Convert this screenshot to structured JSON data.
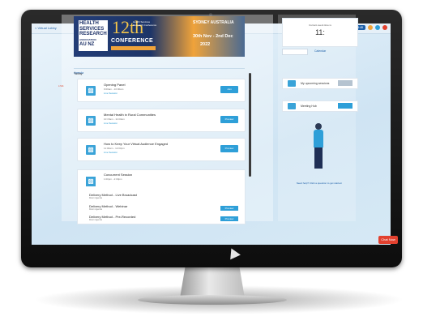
{
  "topbar": {
    "back_label": "< Virtual Lobby",
    "user_label": "Your Profile",
    "timer": "13:48"
  },
  "banner": {
    "org_lines": [
      "HEALTH",
      "SERVICES",
      "RESEARCH",
      "ASSOCIATION",
      "AU NZ"
    ],
    "edition": "12th",
    "subtitle": "Health Services Research Conference",
    "conference": "CONFERENCE",
    "city": "SYDNEY AUSTRALIA",
    "dates": "30th Nov - 2nd Dec",
    "year": "2022"
  },
  "tab_label": "Agenda",
  "section_label": "Today",
  "live_label": "LIVE",
  "cards": [
    {
      "title": "Opening Panel",
      "time": "9:00am - 10:00am",
      "tag": "Live Session",
      "button": "Join"
    },
    {
      "title": "Mental Health in Rural Communities",
      "time": "10:15am - 11:00am",
      "tag": "Live Session",
      "button": "Preview"
    },
    {
      "title": "How to Keep Your Virtual Audience Engaged",
      "time": "11:00am - 12:00pm",
      "tag": "Live Session",
      "button": "Preview"
    }
  ],
  "session": {
    "title": "Concurrent Session",
    "time": "1:00pm - 2:00pm",
    "items": [
      {
        "label": "Delivery Method - Live Broadcast",
        "sub": "Room Agenda",
        "button": ""
      },
      {
        "label": "Delivery Method - Webinar",
        "sub": "Room Agenda",
        "button": "Preview"
      },
      {
        "label": "Delivery Method - Pre-Recorded",
        "sub": "Room Agenda",
        "button": "Preview"
      }
    ]
  },
  "right": {
    "time_label": "Current event time is",
    "time_value": "11:",
    "calendar_label": "Calendar",
    "rows": [
      {
        "label": "My upcoming sessions"
      },
      {
        "label": "Meeting Hub"
      }
    ],
    "bottom_label": "Need help? Click a question to get started."
  },
  "chat_label": "Chat Now",
  "colors": {
    "accent": "#2e9fd8",
    "navy": "#1d3568",
    "orange": "#f0a33a",
    "alert": "#e2412f"
  }
}
